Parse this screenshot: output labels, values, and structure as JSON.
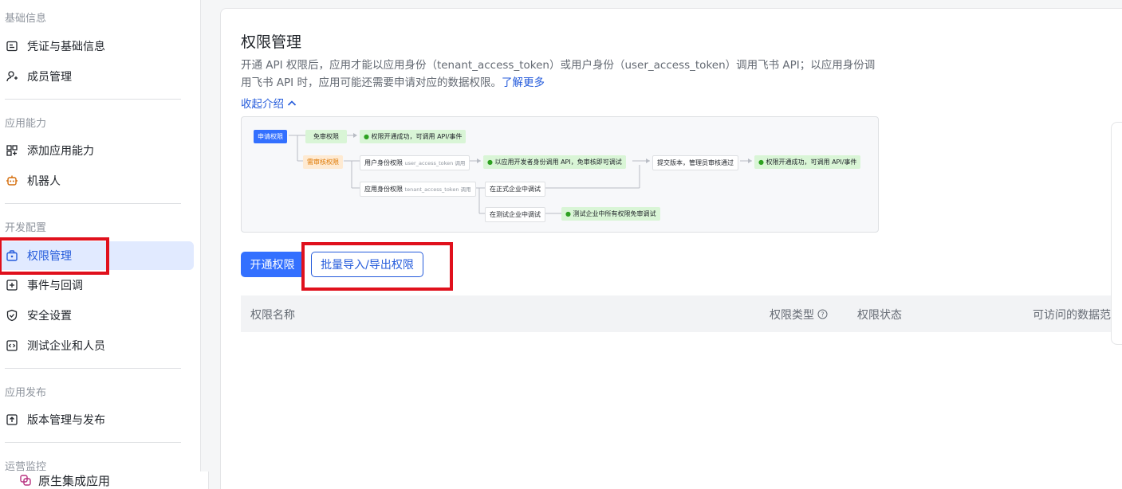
{
  "sidebar": {
    "sections": [
      {
        "title": "基础信息"
      },
      {
        "title": "应用能力"
      },
      {
        "title": "开发配置"
      },
      {
        "title": "应用发布"
      },
      {
        "title": "运营监控"
      }
    ],
    "items": [
      {
        "label": "凭证与基础信息",
        "icon": "id-card-icon"
      },
      {
        "label": "成员管理",
        "icon": "add-member-icon"
      },
      {
        "label": "添加应用能力",
        "icon": "grid-add-icon"
      },
      {
        "label": "机器人",
        "icon": "robot-icon"
      },
      {
        "label": "权限管理",
        "icon": "lock-briefcase-icon"
      },
      {
        "label": "事件与回调",
        "icon": "event-plus-icon"
      },
      {
        "label": "安全设置",
        "icon": "shield-icon"
      },
      {
        "label": "测试企业和人员",
        "icon": "code-icon"
      },
      {
        "label": "版本管理与发布",
        "icon": "upload-icon"
      }
    ],
    "bottom_item": "原生集成应用"
  },
  "main": {
    "title": "权限管理",
    "description": "开通 API 权限后，应用才能以应用身份（tenant_access_token）或用户身份（user_access_token）调用飞书 API；以应用身份调用飞书 API 时，应用可能还需要申请对应的数据权限。",
    "learn_more": "了解更多",
    "collapse": "收起介绍",
    "diagram": {
      "apply": "申请权限",
      "no_review": "免审权限",
      "success1": "权限开通成功，可调用 API/事件",
      "need_review": "需审核权限",
      "user_perm": "用户身份权限",
      "user_perm_sub": "user_access_token 调用",
      "dev_debug": "以应用开发者身份调用 API，免审核即可调试",
      "submit": "提交版本，管理员审核通过",
      "success2": "权限开通成功，可调用 API/事件",
      "app_perm": "应用身份权限",
      "app_perm_sub": "tenant_access_token 调用",
      "formal_debug": "在正式企业中调试",
      "test_debug": "在测试企业中调试",
      "test_free": "测试企业中所有权限免审调试"
    },
    "btn_open": "开通权限",
    "btn_batch": "批量导入/导出权限",
    "table": {
      "col_name": "权限名称",
      "col_type": "权限类型",
      "col_status": "权限状态",
      "col_scope": "可访问的数据范围"
    }
  },
  "colors": {
    "accent": "#3370ff",
    "highlight": "#e0101c",
    "active_bg": "#e1eaff"
  }
}
